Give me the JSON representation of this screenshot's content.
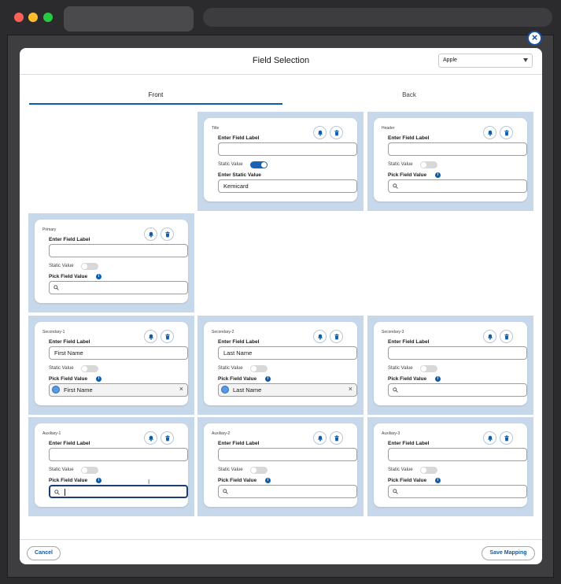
{
  "modal": {
    "title": "Field Selection",
    "select_value": "Apple"
  },
  "tabs": {
    "front": "Front",
    "back": "Back"
  },
  "common": {
    "enter_field_label": "Enter Field Label",
    "static_value": "Static Value",
    "pick_field_value": "Pick Field Value",
    "enter_static_value": "Enter Static Value",
    "info": "i"
  },
  "fields": {
    "title": {
      "zone": "Title",
      "label_value": "",
      "static_on": true,
      "static_value": "Kemicard"
    },
    "header": {
      "zone": "Header",
      "label_value": "",
      "static_on": false,
      "pick_value": ""
    },
    "primary": {
      "zone": "Primary",
      "label_value": "",
      "static_on": false,
      "pick_value": ""
    },
    "secondary1": {
      "zone": "Secondary-1",
      "label_value": "First Name",
      "static_on": false,
      "pick_value": "First Name"
    },
    "secondary2": {
      "zone": "Secondary-2",
      "label_value": "Last Name",
      "static_on": false,
      "pick_value": "Last Name"
    },
    "secondary3": {
      "zone": "Secondary-3",
      "label_value": "",
      "static_on": false,
      "pick_value": ""
    },
    "auxiliary1": {
      "zone": "Auxiliary-1",
      "label_value": "",
      "static_on": false,
      "pick_value": ""
    },
    "auxiliary2": {
      "zone": "Auxiliary-2",
      "label_value": "",
      "static_on": false,
      "pick_value": ""
    },
    "auxiliary3": {
      "zone": "Auxiliary-3",
      "label_value": "",
      "static_on": false,
      "pick_value": ""
    }
  },
  "footer": {
    "cancel": "Cancel",
    "save": "Save Mapping"
  },
  "colors": {
    "accent": "#0b5cab",
    "zone_bg": "#c7d8ea"
  }
}
